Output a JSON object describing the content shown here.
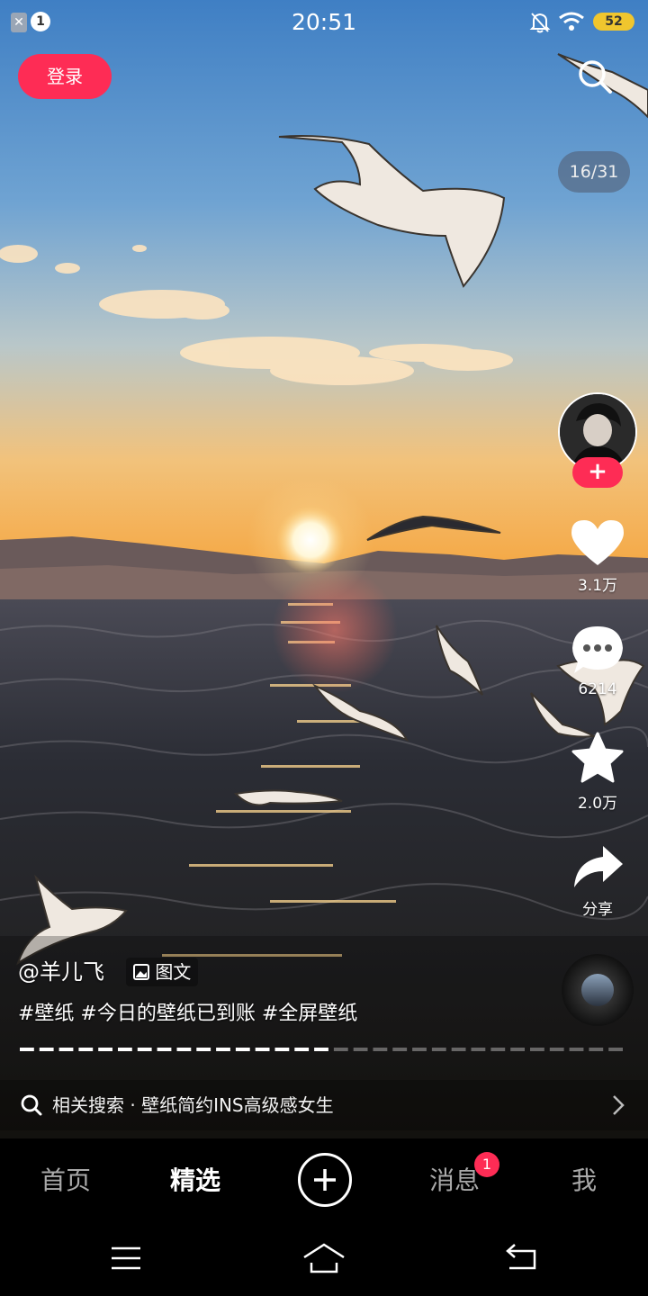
{
  "status_bar": {
    "time": "20:51",
    "notification_count": "1",
    "battery": "52"
  },
  "top": {
    "login_label": "登录",
    "photo_counter": "16/31"
  },
  "actions": {
    "likes": "3.1万",
    "comments": "6214",
    "favorites": "2.0万",
    "share_label": "分享"
  },
  "post": {
    "author": "@羊儿飞",
    "type_tag": "图文",
    "caption": "#壁纸 #今日的壁纸已到账 #全屏壁纸",
    "progress": 0.51
  },
  "related_search": {
    "text": "相关搜索 · 壁纸简约INS高级感女生"
  },
  "bottom_nav": {
    "items": [
      {
        "label": "首页"
      },
      {
        "label": "精选"
      },
      {
        "label": "消息",
        "badge": "1"
      },
      {
        "label": "我"
      }
    ]
  },
  "icons": {
    "search": "search-icon",
    "heart": "heart-icon",
    "comment": "comment-icon",
    "star": "star-icon",
    "share": "share-icon",
    "plus": "plus-icon"
  },
  "colors": {
    "accent": "#fe2c55",
    "battery": "#f0c62e"
  }
}
